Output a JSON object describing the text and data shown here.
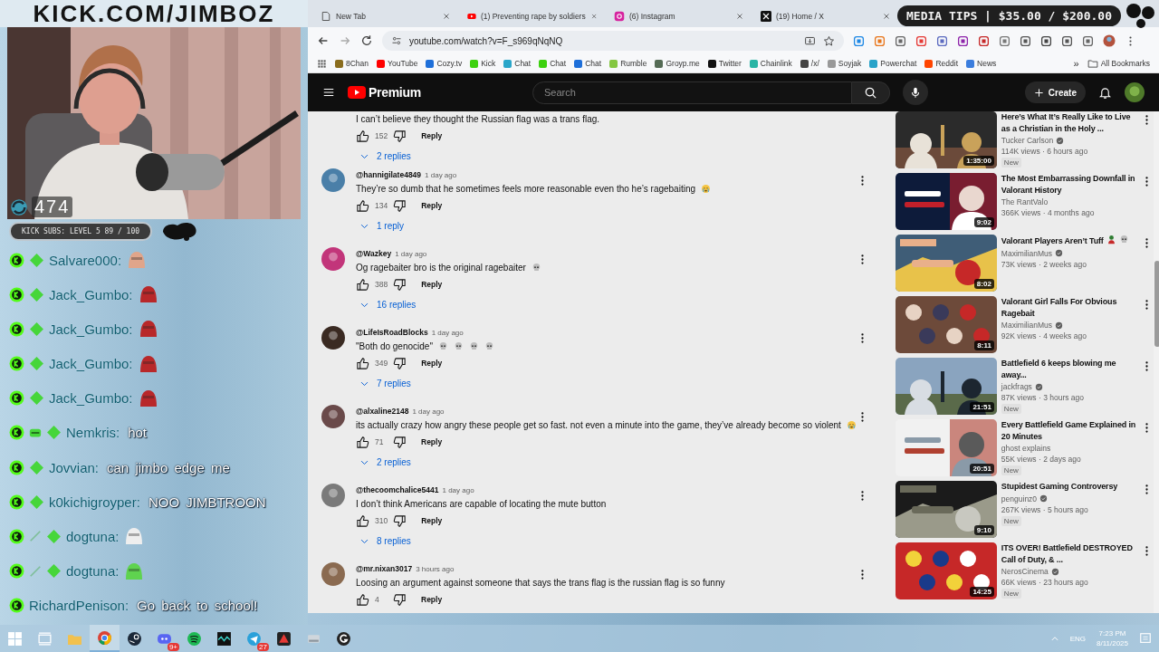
{
  "stream": {
    "banner": "KICK.COM/JIMBOZ",
    "viewer_count": "474",
    "subs_goal": "KICK SUBS: LEVEL 5 89 / 100",
    "tips_goal": "MEDIA TIPS | $35.00 / $200.00"
  },
  "chat": [
    {
      "username": "Salvare000:",
      "badges": [
        {
          "kind": "kick"
        },
        {
          "kind": "sub"
        }
      ],
      "kind": "emote",
      "color": "#e0a58a"
    },
    {
      "username": "Jack_Gumbo:",
      "badges": [
        {
          "kind": "kick"
        },
        {
          "kind": "sub"
        }
      ],
      "kind": "emote",
      "color": "#b8282a"
    },
    {
      "username": "Jack_Gumbo:",
      "badges": [
        {
          "kind": "kick"
        },
        {
          "kind": "sub"
        }
      ],
      "kind": "emote",
      "color": "#b8282a"
    },
    {
      "username": "Jack_Gumbo:",
      "badges": [
        {
          "kind": "kick"
        },
        {
          "kind": "sub"
        }
      ],
      "kind": "emote",
      "color": "#b8282a"
    },
    {
      "username": "Jack_Gumbo:",
      "badges": [
        {
          "kind": "kick"
        },
        {
          "kind": "sub"
        }
      ],
      "kind": "emote",
      "color": "#b8282a"
    },
    {
      "username": "Nemkris:",
      "badges": [
        {
          "kind": "kick"
        },
        {
          "kind": "bar"
        },
        {
          "kind": "sub"
        }
      ],
      "kind": "text",
      "message": "hot"
    },
    {
      "username": "Jovvian:",
      "badges": [
        {
          "kind": "kick"
        },
        {
          "kind": "sub"
        }
      ],
      "kind": "text",
      "message": "can jimbo edge me"
    },
    {
      "username": "k0kichigroyper:",
      "badges": [
        {
          "kind": "kick"
        },
        {
          "kind": "sub"
        }
      ],
      "kind": "text",
      "message": "NOO JIMBTROON"
    },
    {
      "username": "dogtuna:",
      "badges": [
        {
          "kind": "kick"
        },
        {
          "kind": "sword"
        },
        {
          "kind": "sub"
        }
      ],
      "kind": "emote",
      "color": "#eeeeee"
    },
    {
      "username": "dogtuna:",
      "badges": [
        {
          "kind": "kick"
        },
        {
          "kind": "sword"
        },
        {
          "kind": "sub"
        }
      ],
      "kind": "emote",
      "color": "#5fd34f"
    },
    {
      "username": "RichardPenison:",
      "badges": [
        {
          "kind": "kick"
        }
      ],
      "kind": "text",
      "message": "Go back to school!"
    }
  ],
  "browser": {
    "tabs": [
      {
        "title": "New Tab",
        "kind": "newtab",
        "selected": false
      },
      {
        "title": "(1) Preventing rape by soldiers",
        "kind": "youtube",
        "selected": false
      },
      {
        "title": "(6) Instagram",
        "kind": "instagram",
        "selected": false
      },
      {
        "title": "(19) Home / X",
        "kind": "x",
        "selected": false
      }
    ],
    "url": "youtube.com/watch?v=F_s969qNqNQ",
    "bookmarks": [
      {
        "label": "8Chan",
        "color": "#8a6d1e"
      },
      {
        "label": "YouTube",
        "color": "#ff0000"
      },
      {
        "label": "Cozy.tv",
        "color": "#1e6fd9"
      },
      {
        "label": "Kick",
        "color": "#3dd10f"
      },
      {
        "label": "Chat",
        "color": "#2aa6c9"
      },
      {
        "label": "Chat",
        "color": "#3dd10f"
      },
      {
        "label": "Chat",
        "color": "#1e6fd9"
      },
      {
        "label": "Rumble",
        "color": "#85c742"
      },
      {
        "label": "Groyp.me",
        "color": "#556b55"
      },
      {
        "label": "Twitter",
        "color": "#111111"
      },
      {
        "label": "Chainlink",
        "color": "#2ab5a5"
      },
      {
        "label": "/x/",
        "color": "#444444"
      },
      {
        "label": "Soyjak",
        "color": "#999999"
      },
      {
        "label": "Powerchat",
        "color": "#29a3c9"
      },
      {
        "label": "Reddit",
        "color": "#ff4500"
      },
      {
        "label": "News",
        "color": "#3b7ddd"
      }
    ],
    "bookmarks_more": "»",
    "all_bookmarks": "All Bookmarks"
  },
  "youtube": {
    "logo": "Premium",
    "search": {
      "placeholder": "Search"
    },
    "create": "Create",
    "comments": [
      {
        "text": "I can’t believe they thought the Russian flag was a trans flag.",
        "likes": "152",
        "reply": "Reply",
        "replies": "2 replies"
      },
      {
        "author": "@hannigilate4849",
        "time": "1 day ago",
        "text": "They’re so dumb that he sometimes feels more reasonable even tho he’s ragebaiting",
        "emojis": [
          {
            "kind": "crying"
          }
        ],
        "likes": "134",
        "reply": "Reply",
        "replies": "1 reply"
      },
      {
        "author": "@Wazkey",
        "time": "1 day ago",
        "text": "Og ragebaiter bro is the original ragebaiter",
        "emojis": [
          {
            "kind": "skull"
          }
        ],
        "likes": "388",
        "reply": "Reply",
        "replies": "16 replies"
      },
      {
        "author": "@LifeIsRoadBlocks",
        "time": "1 day ago",
        "text": "\"Both do genocide\"",
        "emojis": [
          {
            "kind": "skull"
          },
          {
            "kind": "skull"
          },
          {
            "kind": "skull"
          },
          {
            "kind": "skull"
          }
        ],
        "likes": "349",
        "reply": "Reply",
        "replies": "7 replies"
      },
      {
        "author": "@alxaline2148",
        "time": "1 day ago",
        "text": "its actually crazy how angry these people get so fast. not even a minute into the game, they’ve already become so violent",
        "emojis": [
          {
            "kind": "crying"
          }
        ],
        "likes": "71",
        "reply": "Reply",
        "replies": "2 replies"
      },
      {
        "author": "@thecoomchalice5441",
        "time": "1 day ago",
        "text": "I don’t think Americans are capable of locating the mute button",
        "likes": "310",
        "reply": "Reply",
        "replies": "8 replies"
      },
      {
        "author": "@mr.nixan3017",
        "time": "3 hours ago",
        "text": "Loosing an argument against someone that says the trans flag is the russian flag is so funny",
        "likes": "4",
        "reply": "Reply"
      }
    ],
    "related": [
      {
        "title": "Here’s What It’s Really Like to Live as a Christian in the Holy ...",
        "channel": "Tucker Carlson",
        "verified": true,
        "stats": "114K views · 6 hours ago",
        "badge": "New",
        "duration": "1:35:00"
      },
      {
        "title": "The Most Embarrassing Downfall in Valorant History",
        "channel": "The RantValo",
        "verified": false,
        "stats": "366K views · 4 months ago",
        "duration": "9:02"
      },
      {
        "title": "Valorant Players Aren’t Tuff",
        "emojis": [
          {
            "kind": "figure"
          },
          {
            "kind": "skull"
          }
        ],
        "channel": "MaximilianMus",
        "verified": true,
        "stats": "73K views · 2 weeks ago",
        "duration": "8:02"
      },
      {
        "title": "Valorant Girl Falls For Obvious Ragebait",
        "channel": "MaximilianMus",
        "verified": true,
        "stats": "92K views · 4 weeks ago",
        "duration": "8:11"
      },
      {
        "title": "Battlefield 6 keeps blowing me away...",
        "channel": "jackfrags",
        "verified": true,
        "stats": "87K views · 3 hours ago",
        "badge": "New",
        "duration": "21:51"
      },
      {
        "title": "Every Battlefield Game Explained in 20 Minutes",
        "channel": "ghost explains",
        "verified": false,
        "stats": "55K views · 2 days ago",
        "badge": "New",
        "duration": "20:51"
      },
      {
        "title": "Stupidest Gaming Controversy",
        "channel": "penguinz0",
        "verified": true,
        "stats": "267K views · 5 hours ago",
        "badge": "New",
        "duration": "9:10"
      },
      {
        "title": "ITS OVER! Battlefield DESTROYED Call of Duty, & ...",
        "channel": "NerosCinema",
        "verified": true,
        "stats": "66K views · 23 hours ago",
        "badge": "New",
        "duration": "14:25"
      }
    ]
  },
  "taskbar": {
    "apps": [
      {
        "kind": "start",
        "selected": false
      },
      {
        "kind": "taskview",
        "selected": false
      },
      {
        "kind": "explorer",
        "selected": false
      },
      {
        "kind": "chrome",
        "selected": true
      },
      {
        "kind": "steam",
        "selected": false
      },
      {
        "kind": "discord",
        "selected": false,
        "badge": "9+"
      },
      {
        "kind": "spotify",
        "selected": false
      },
      {
        "kind": "wave",
        "selected": false
      },
      {
        "kind": "telegram",
        "selected": false,
        "badge": "27"
      },
      {
        "kind": "triangle",
        "selected": false
      },
      {
        "kind": "drive",
        "selected": false
      },
      {
        "kind": "logitech",
        "selected": false
      }
    ],
    "language": "ENG",
    "time": "7:23 PM",
    "date": "8/11/2025"
  }
}
